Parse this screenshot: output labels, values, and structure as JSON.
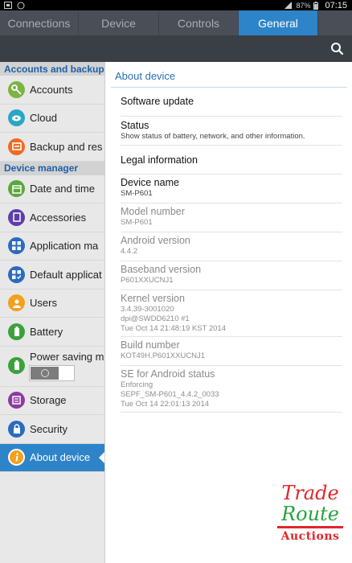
{
  "status_bar": {
    "battery": "87%",
    "time": "07:15"
  },
  "tabs": [
    {
      "label": "Connections",
      "active": false
    },
    {
      "label": "Device",
      "active": false
    },
    {
      "label": "Controls",
      "active": false
    },
    {
      "label": "General",
      "active": true
    }
  ],
  "sidebar": {
    "sections": [
      {
        "header": "Accounts and backup",
        "items": [
          {
            "label": "Accounts",
            "icon": "key-icon",
            "color": "#7cb342"
          },
          {
            "label": "Cloud",
            "icon": "cloud-icon",
            "color": "#29a7c5"
          },
          {
            "label": "Backup and res",
            "icon": "backup-icon",
            "color": "#f06b22"
          }
        ]
      },
      {
        "header": "Device manager",
        "items": [
          {
            "label": "Date and time",
            "icon": "calendar-icon",
            "color": "#5aa83a"
          },
          {
            "label": "Accessories",
            "icon": "accessories-icon",
            "color": "#5b3eab"
          },
          {
            "label": "Application ma",
            "icon": "apps-icon",
            "color": "#2a6bc0"
          },
          {
            "label": "Default applicat",
            "icon": "default-apps-icon",
            "color": "#2a6bc0"
          },
          {
            "label": "Users",
            "icon": "users-icon",
            "color": "#f4a11f"
          },
          {
            "label": "Battery",
            "icon": "battery-icon",
            "color": "#3ba23b"
          },
          {
            "label": "Power saving m",
            "icon": "power-saving-icon",
            "color": "#3ba23b"
          },
          {
            "label": "Storage",
            "icon": "storage-icon",
            "color": "#8d3a9e"
          },
          {
            "label": "Security",
            "icon": "lock-icon",
            "color": "#2a6bc0"
          },
          {
            "label": "About device",
            "icon": "info-icon",
            "color": "#f4a11f"
          }
        ]
      }
    ]
  },
  "main": {
    "title": "About device",
    "rows": [
      {
        "title": "Software update",
        "sub": "",
        "dim": false
      },
      {
        "title": "Status",
        "sub": "Show status of battery, network, and other information.",
        "dim": false
      },
      {
        "title": "Legal information",
        "sub": "",
        "dim": false
      },
      {
        "title": "Device name",
        "sub": "SM-P601",
        "dim": false
      },
      {
        "title": "Model number",
        "sub": "SM-P601",
        "dim": true
      },
      {
        "title": "Android version",
        "sub": "4.4.2",
        "dim": true
      },
      {
        "title": "Baseband version",
        "sub": "P601XXUCNJ1",
        "dim": true
      },
      {
        "title": "Kernel version",
        "sub": "3.4.39-3001020\ndpi@SWDD6210 #1\nTue Oct 14 21:48:19 KST 2014",
        "dim": true
      },
      {
        "title": "Build number",
        "sub": "KOT49H.P601XXUCNJ1",
        "dim": true
      },
      {
        "title": "SE for Android status",
        "sub": "Enforcing\nSEPF_SM-P601_4.4.2_0033\nTue Oct 14 22:01:13 2014",
        "dim": true
      }
    ]
  },
  "watermark": {
    "line1": "Trade",
    "line2": "Route",
    "line3": "Auctions"
  }
}
